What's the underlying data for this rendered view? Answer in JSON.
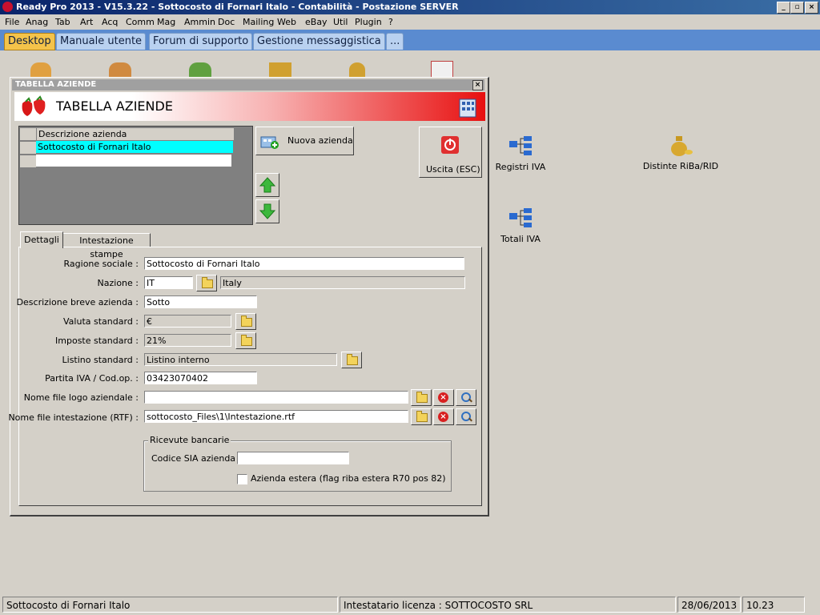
{
  "window": {
    "title": "Ready Pro 2013 - V15.3.22 - Sottocosto di Fornari Italo - Contabilità - Postazione SERVER"
  },
  "menu": [
    "File",
    "Anag",
    "Tab",
    "Art",
    "Acq",
    "Comm",
    "Mag",
    "Ammin",
    "Doc",
    "Mailing",
    "Web",
    "eBay",
    "Util",
    "Plugin",
    "?"
  ],
  "tabs": [
    "Desktop",
    "Manuale utente",
    "Forum di supporto",
    "Gestione messaggistica",
    "..."
  ],
  "desktop_icons": {
    "registri": "Registri IVA",
    "distinte": "Distinte RiBa/RID",
    "totali": "Totali IVA"
  },
  "dialog": {
    "title": "TABELLA AZIENDE",
    "banner": "TABELLA AZIENDE",
    "grid": {
      "header": "Descrizione azienda",
      "rows": [
        "Sottocosto di Fornari Italo"
      ]
    },
    "new_button": "Nuova azienda",
    "exit_button": "Uscita (ESC)",
    "tabs": [
      "Dettagli",
      "Intestazione stampe"
    ],
    "form": {
      "ragione_label": "Ragione sociale :",
      "ragione_value": "Sottocosto di Fornari Italo",
      "nazione_label": "Nazione :",
      "nazione_code": "IT",
      "nazione_name": "Italy",
      "descr_label": "Descrizione breve azienda :",
      "descr_value": "Sotto",
      "valuta_label": "Valuta standard :",
      "valuta_value": "€",
      "imposte_label": "Imposte standard :",
      "imposte_value": "21%",
      "listino_label": "Listino standard :",
      "listino_value": "Listino interno",
      "piva_label": "Partita IVA / Cod.op. :",
      "piva_value": "03423070402",
      "logo_label": "Nome file logo aziendale :",
      "logo_value": "",
      "rtf_label": "Nome file intestazione (RTF) :",
      "rtf_value": "sottocosto_Files\\1\\Intestazione.rtf",
      "ricevute_legend": "Ricevute bancarie",
      "sia_label": "Codice SIA azienda :",
      "sia_value": "",
      "estera_label": "Azienda estera (flag riba estera R70 pos 82)"
    }
  },
  "statusbar": {
    "company": "Sottocosto di Fornari Italo",
    "license": "Intestatario licenza : SOTTOCOSTO SRL",
    "date": "28/06/2013",
    "time": "10.23"
  },
  "colors": {
    "titlebar": "#0a246a",
    "tabbar": "#5a8bd0",
    "active_tab": "#f4c34a",
    "banner_red": "#e81010",
    "grid_selected": "#00ffff"
  }
}
